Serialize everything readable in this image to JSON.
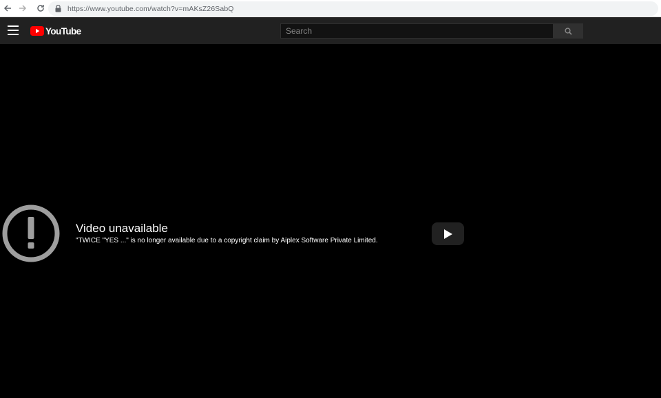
{
  "browser": {
    "url": "https://www.youtube.com/watch?v=mAKsZ26SabQ",
    "icons": {
      "back": "arrow-left-icon",
      "forward": "arrow-right-icon",
      "reload": "reload-icon",
      "lock": "lock-icon"
    }
  },
  "masthead": {
    "logo_text": "YouTube",
    "search_placeholder": "Search",
    "icons": {
      "menu": "hamburger-menu-icon",
      "search": "magnifier-icon"
    },
    "colors": {
      "background": "#212121",
      "logo_red": "#ff0000"
    }
  },
  "player": {
    "error_title": "Video unavailable",
    "error_reason": "\"TWICE \"YES ...\" is no longer available due to a copyright claim by Aiplex Software Private Limited.",
    "icons": {
      "error": "exclamation-circle-icon",
      "play": "play-icon"
    },
    "colors": {
      "error_icon": "#9e9e9e",
      "play_button": "#212121"
    }
  }
}
